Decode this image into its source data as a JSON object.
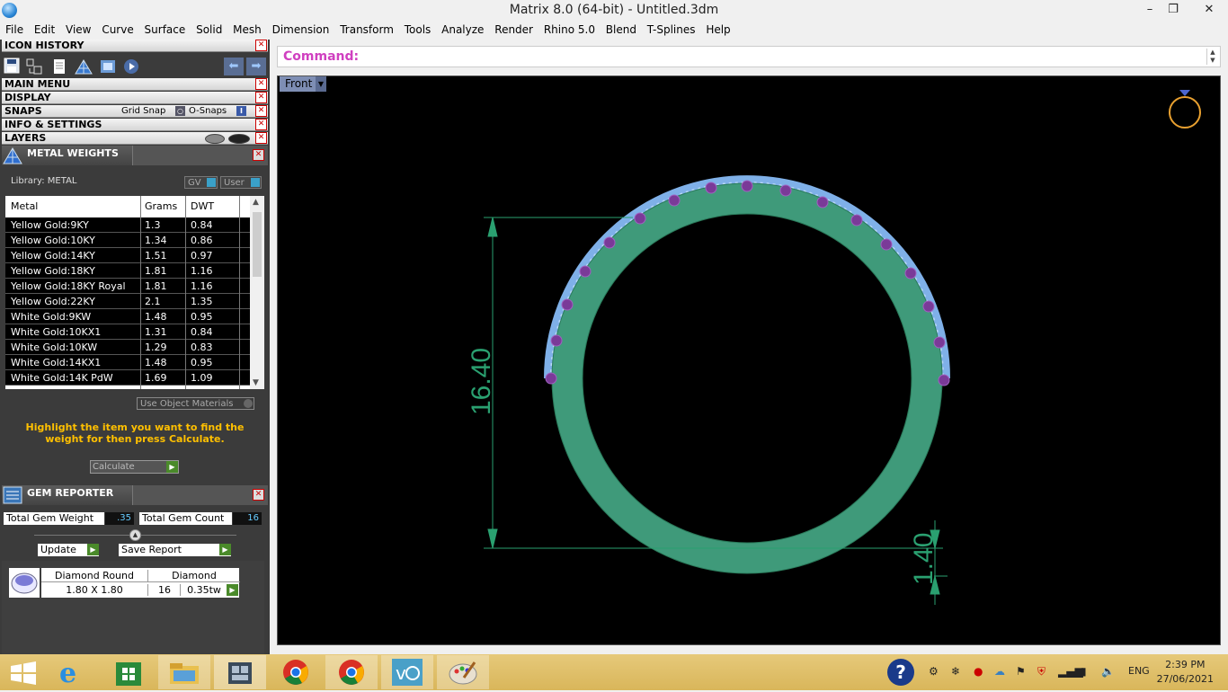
{
  "window": {
    "title": "Matrix 8.0 (64-bit) - Untitled.3dm",
    "minimize": "–",
    "restore": "❐",
    "close": "✕"
  },
  "menu": [
    "File",
    "Edit",
    "View",
    "Curve",
    "Surface",
    "Solid",
    "Mesh",
    "Dimension",
    "Transform",
    "Tools",
    "Analyze",
    "Render",
    "Rhino 5.0",
    "Blend",
    "T-Splines",
    "Help"
  ],
  "panels": {
    "icon_history": "ICON HISTORY",
    "main_menu": "MAIN MENU",
    "display": "DISPLAY",
    "snaps": "SNAPS",
    "grid_snap": "Grid Snap",
    "o_snaps": "O-Snaps",
    "info_settings": "INFO & SETTINGS",
    "layers": "LAYERS"
  },
  "metal_weights": {
    "title": "METAL WEIGHTS",
    "library": "Library: METAL",
    "gv": "GV",
    "user": "User",
    "headers": [
      "Metal",
      "Grams",
      "DWT"
    ],
    "rows": [
      [
        "Yellow Gold:9KY",
        "1.3",
        "0.84"
      ],
      [
        "Yellow Gold:10KY",
        "1.34",
        "0.86"
      ],
      [
        "Yellow Gold:14KY",
        "1.51",
        "0.97"
      ],
      [
        "Yellow Gold:18KY",
        "1.81",
        "1.16"
      ],
      [
        "Yellow Gold:18KY Royal",
        "1.81",
        "1.16"
      ],
      [
        "Yellow Gold:22KY",
        "2.1",
        "1.35"
      ],
      [
        "White Gold:9KW",
        "1.48",
        "0.95"
      ],
      [
        "White Gold:10KX1",
        "1.31",
        "0.84"
      ],
      [
        "White Gold:10KW",
        "1.29",
        "0.83"
      ],
      [
        "White Gold:14KX1",
        "1.48",
        "0.95"
      ],
      [
        "White Gold:14K PdW",
        "1.69",
        "1.09"
      ]
    ],
    "use_object_materials": "Use Object Materials",
    "hint": "Highlight the item you want to find the weight for then press Calculate.",
    "calculate": "Calculate"
  },
  "gem_reporter": {
    "title": "GEM REPORTER",
    "total_weight_label": "Total Gem Weight",
    "total_weight": ".35",
    "total_count_label": "Total Gem Count",
    "total_count": "16",
    "update": "Update",
    "save_report": "Save Report",
    "gem_name": "Diamond Round",
    "gem_material": "Diamond",
    "gem_size": "1.80 X 1.80",
    "gem_count": "16",
    "gem_weight": "0.35tw"
  },
  "command": {
    "label": "Command:",
    "value": ""
  },
  "viewport": {
    "name": "Front",
    "dim_height": "16.40",
    "dim_thickness": "1.40",
    "colors": {
      "band": "#3f9a7a",
      "stone": "#7a3a98",
      "dim": "#2aa070",
      "accent": "#d040c0"
    }
  },
  "taskbar": {
    "lang": "ENG",
    "time": "2:39 PM",
    "date": "27/06/2021",
    "apps": [
      "start-icon",
      "internet-explorer-icon",
      "store-icon",
      "file-explorer-icon",
      "matrix-icon",
      "chrome-icon",
      "chrome-icon",
      "vectorworks-icon",
      "paint-icon"
    ]
  }
}
